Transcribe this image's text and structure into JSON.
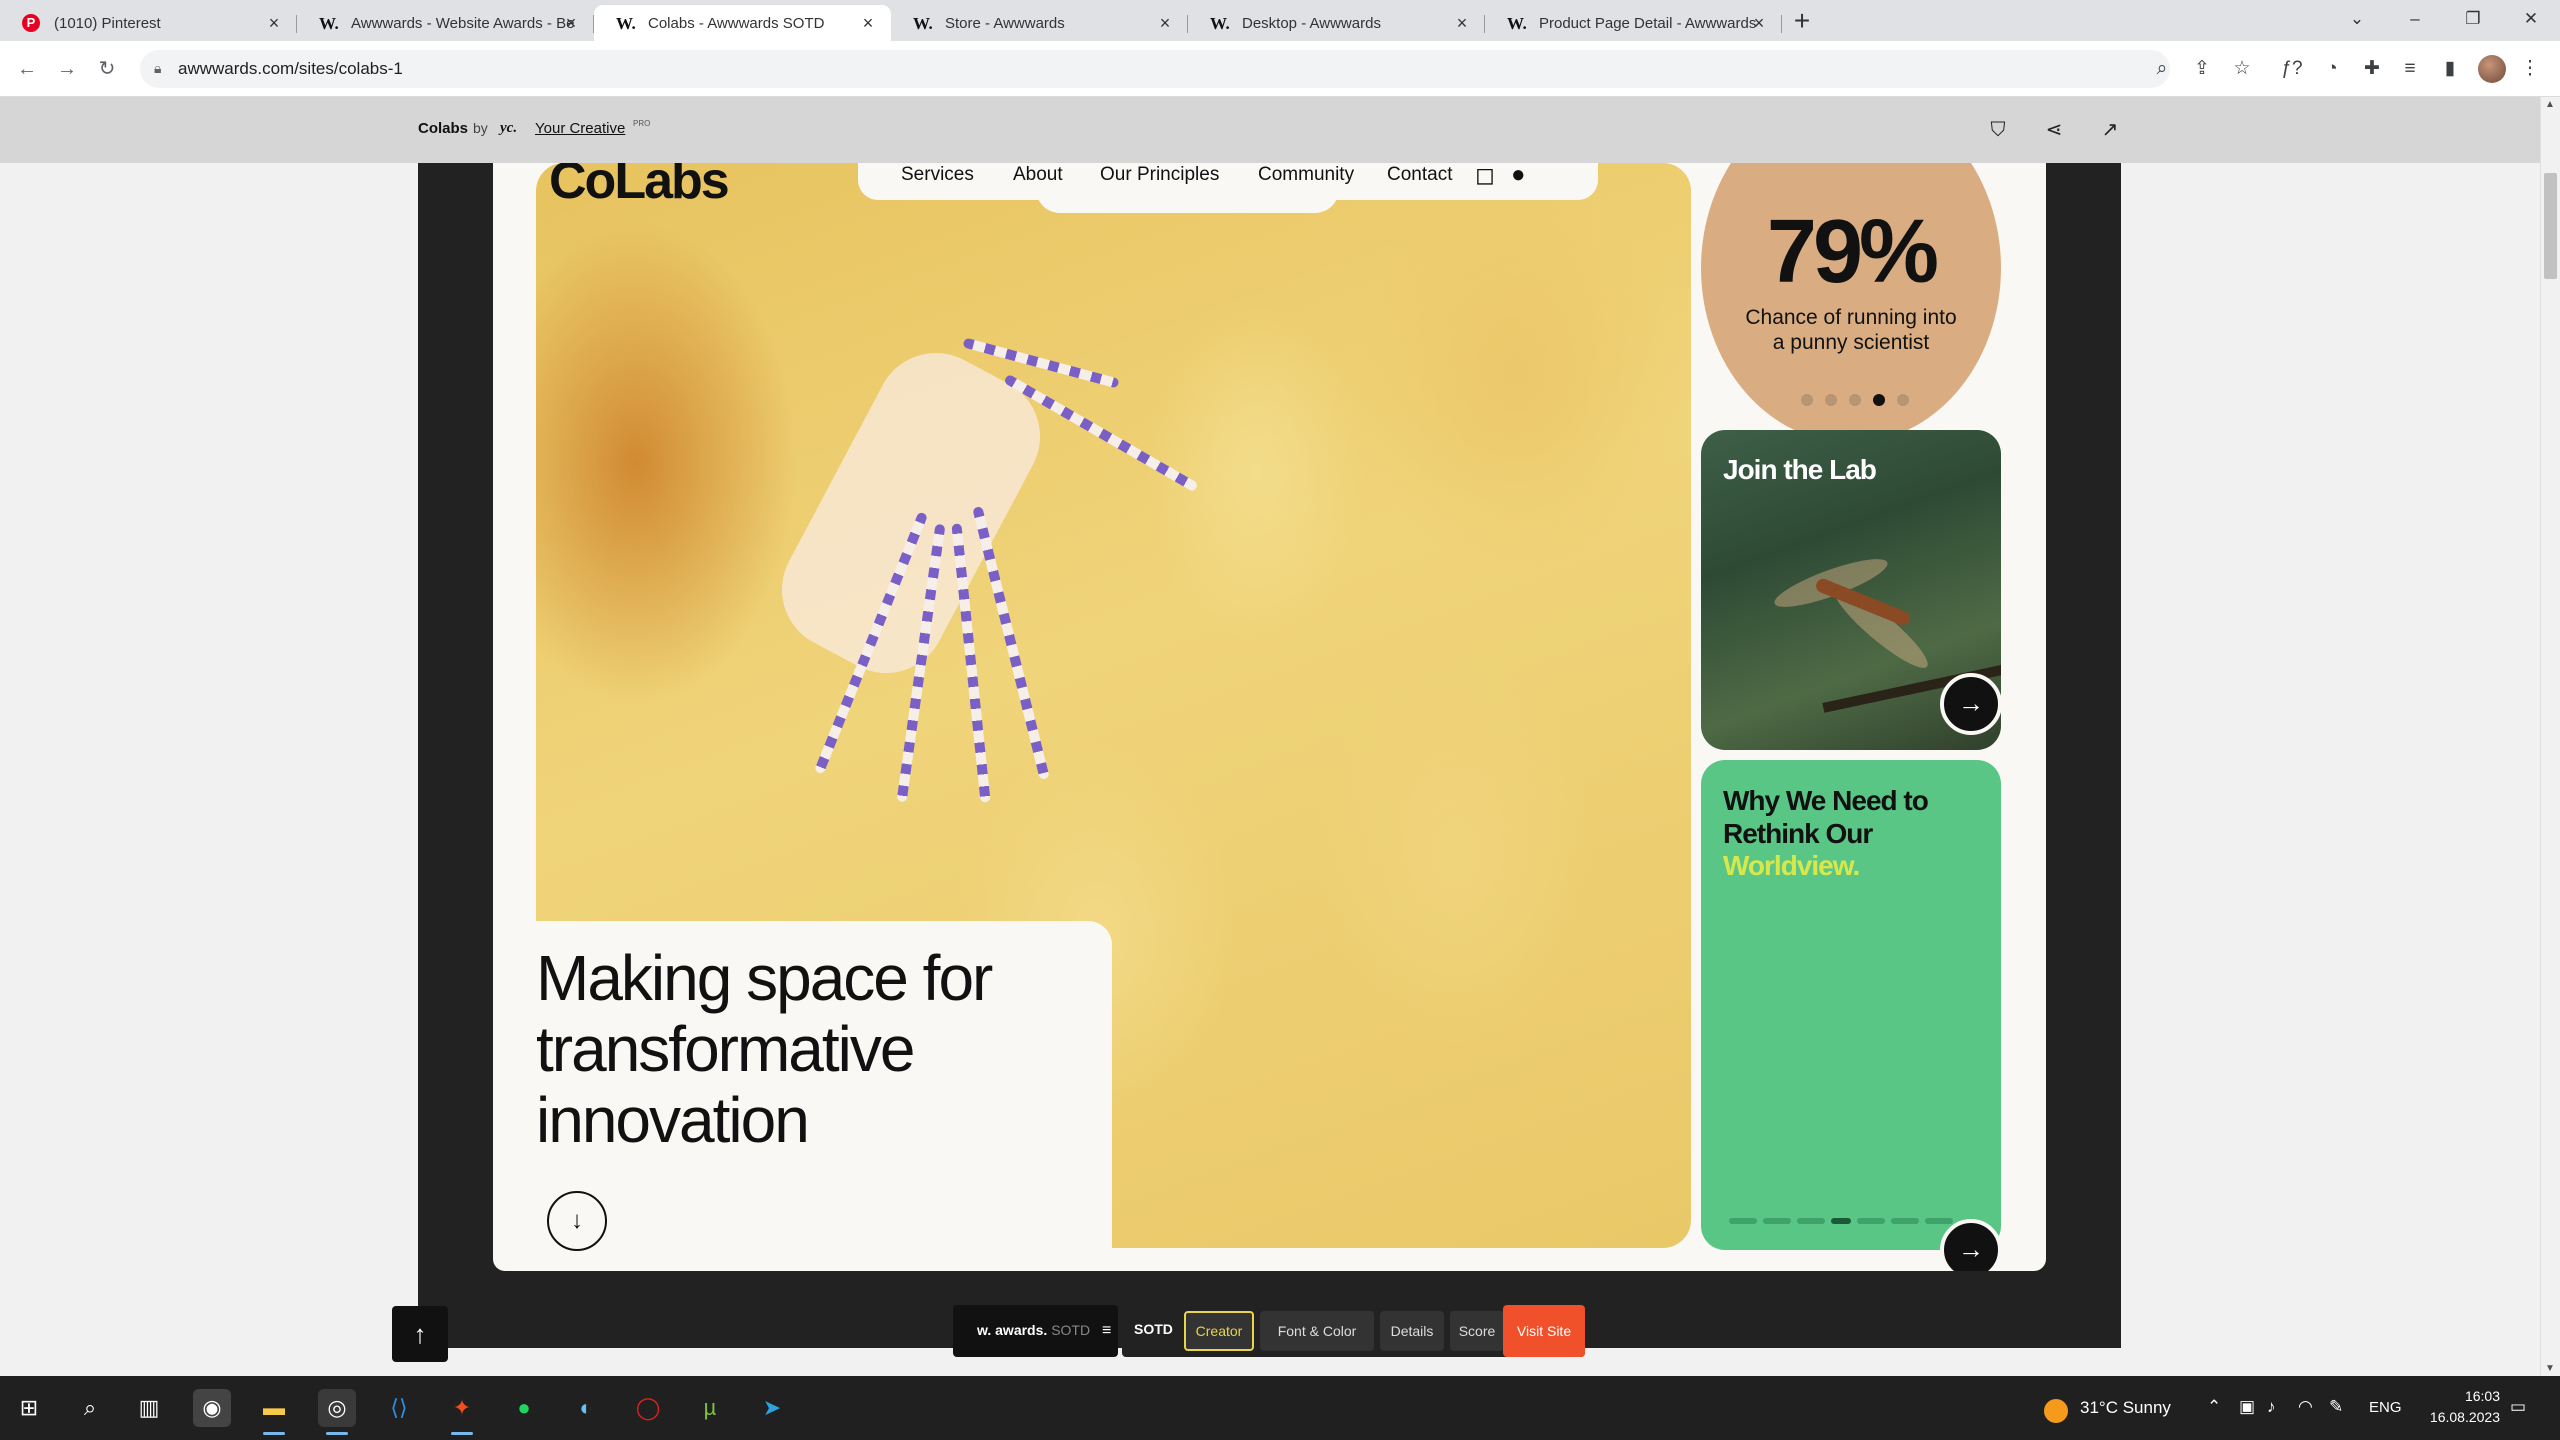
{
  "browser": {
    "tabs": [
      {
        "title": "(1010) Pinterest",
        "icon": "pinterest-icon",
        "active": false
      },
      {
        "title": "Awwwards - Website Awards - Be",
        "icon": "awwwards-icon",
        "active": false
      },
      {
        "title": "Colabs - Awwwards SOTD",
        "icon": "awwwards-icon",
        "active": true
      },
      {
        "title": "Store - Awwwards",
        "icon": "awwwards-icon",
        "active": false
      },
      {
        "title": "Desktop - Awwwards",
        "icon": "awwwards-icon",
        "active": false
      },
      {
        "title": "Product Page Detail - Awwwards",
        "icon": "awwwards-icon",
        "active": false
      }
    ],
    "tab_icon_glyph": "W.",
    "new_tab": "+",
    "url": "awwwards.com/sites/colabs-1"
  },
  "awwwards_header": {
    "site_name": "Colabs",
    "by": "by",
    "creator_logo": "yc.",
    "creator": "Your Creative",
    "creator_badge": "PRO"
  },
  "site": {
    "logo": "CoLabs",
    "nav": [
      "Services",
      "About",
      "Our Principles",
      "Community",
      "Contact"
    ],
    "stat": {
      "value": "79%",
      "caption": "Chance of running into a punny scientist",
      "dots": 5,
      "active_dot": 3,
      "color": "#d9ad81"
    },
    "join_card": {
      "title": "Join the Lab"
    },
    "rethink_card": {
      "title": "Why We Need to Rethink Our",
      "accent": "Worldview.",
      "color": "#5ac685",
      "accent_color": "#d8e84a",
      "bars": 7,
      "active_bar": 3
    },
    "hero": "Making space for transformative innovation"
  },
  "sotd_bar": {
    "brand": "w. awards.",
    "tag": "SOTD",
    "tabs": [
      "SOTD",
      "Creator",
      "Font & Color",
      "Details",
      "Score"
    ],
    "active_tab": "Creator",
    "visit": "Visit Site",
    "visit_color": "#f0502a"
  },
  "taskbar": {
    "weather": "31°C  Sunny",
    "language": "ENG",
    "time": "16:03",
    "date": "16.08.2023"
  }
}
